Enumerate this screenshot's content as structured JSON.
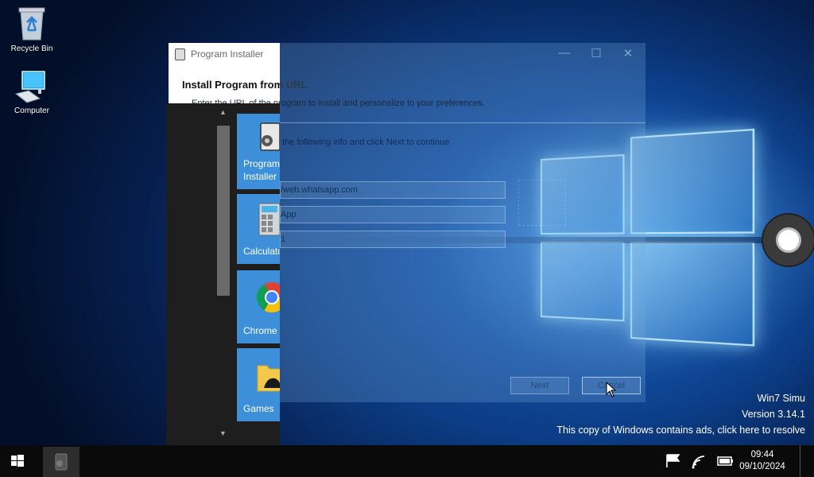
{
  "desktop": {
    "icons": [
      {
        "label": "Recycle Bin",
        "icon": "recycle-bin-icon"
      },
      {
        "label": "Computer",
        "icon": "computer-icon"
      }
    ],
    "watermark": {
      "line1": "Win7 Simu",
      "line2": "Version 3.14.1",
      "line3": "This copy of Windows contains ads, click here to resolve"
    }
  },
  "installer": {
    "title": "Program Installer",
    "heading": "Install Program from URL",
    "description_visible": "Enter the URL of the program to install and personalize to your preferences.",
    "instruction_visible": "the following info and click Next to continue.",
    "url_value": "/web.whatsapp.com",
    "name_value": "App",
    "third_value": "1",
    "next_label": "Next",
    "cancel_label": "Cancel",
    "window_controls": [
      "minimize-icon",
      "maximize-icon",
      "close-icon"
    ]
  },
  "start_menu": {
    "tiles": [
      {
        "label": "Program\nInstaller",
        "icon": "program-installer-icon"
      },
      {
        "label": "Calculator",
        "icon": "calculator-icon"
      },
      {
        "label": "Chrome",
        "icon": "chrome-icon"
      },
      {
        "label": "Games",
        "icon": "games-folder-icon"
      }
    ]
  },
  "taskbar": {
    "time": "09:44",
    "date": "09/10/2024",
    "tray_icons": [
      "flag-icon",
      "network-icon",
      "battery-icon"
    ]
  },
  "colors": {
    "tile_blue": "#3d8fd9",
    "start_menu_bg": "#1e1e1e",
    "taskbar_bg": "#0a0a0a"
  }
}
